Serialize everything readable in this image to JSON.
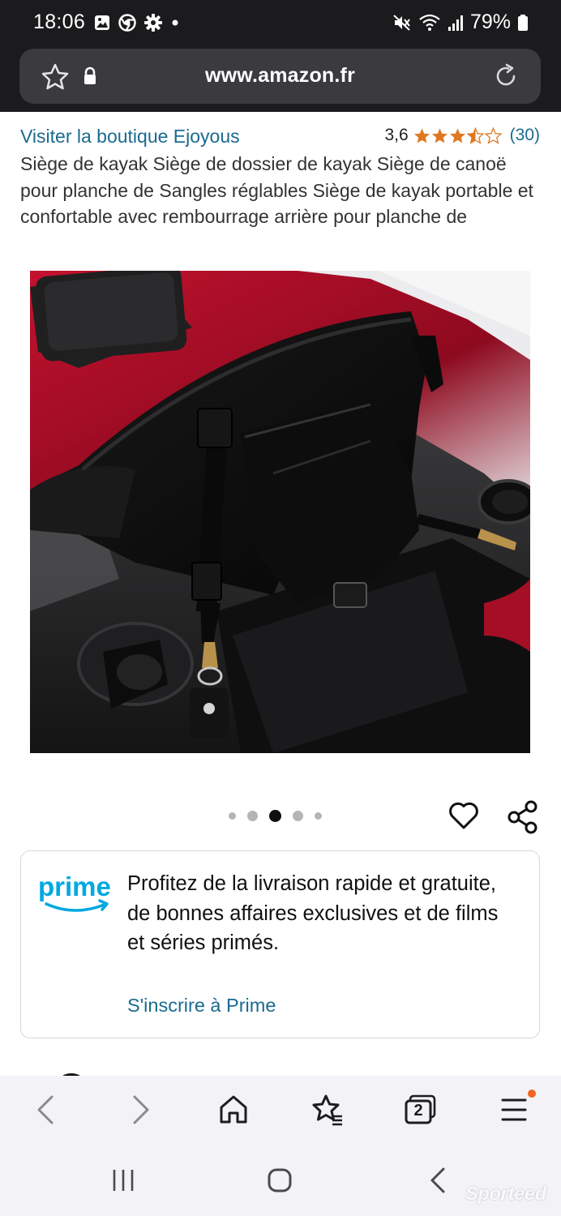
{
  "status_bar": {
    "time": "18:06",
    "battery": "79%",
    "left_icons": [
      "gallery-icon",
      "chrome-icon",
      "gear-icon",
      "dot-icon"
    ],
    "right_icons": [
      "mute-icon",
      "wifi-icon",
      "signal-icon",
      "battery-icon"
    ]
  },
  "browser": {
    "url": "www.amazon.fr"
  },
  "product": {
    "store_link": "Visiter la boutique Ejoyous",
    "rating_value": "3,6",
    "rating_count": "(30)",
    "rating_stars": 3.5,
    "title": "Siège de kayak Siège de dossier de kayak Siège de canoë pour planche de Sangles réglables Siège de kayak portable et confortable avec rembourrage arrière pour planche de",
    "image_count": 5,
    "active_image": 3
  },
  "prime": {
    "logo_text": "prime",
    "text": "Profitez de la livraison rapide et gratuite, de bonnes affaires exclusives et de films et séries primés.",
    "link": "S'inscrire à Prime"
  },
  "toolbar": {
    "tab_count": "2",
    "items": [
      "back-icon",
      "forward-icon",
      "home-icon",
      "bookmarks-icon",
      "tabs-icon",
      "menu-icon"
    ]
  },
  "navbar": {
    "items": [
      "recents-icon",
      "home-nav-icon",
      "back-nav-icon"
    ],
    "watermark": "Sporteed"
  },
  "colors": {
    "link": "#1a6a8f",
    "star": "#de7921",
    "prime_blue": "#00a8e1",
    "notification": "#f26522"
  }
}
